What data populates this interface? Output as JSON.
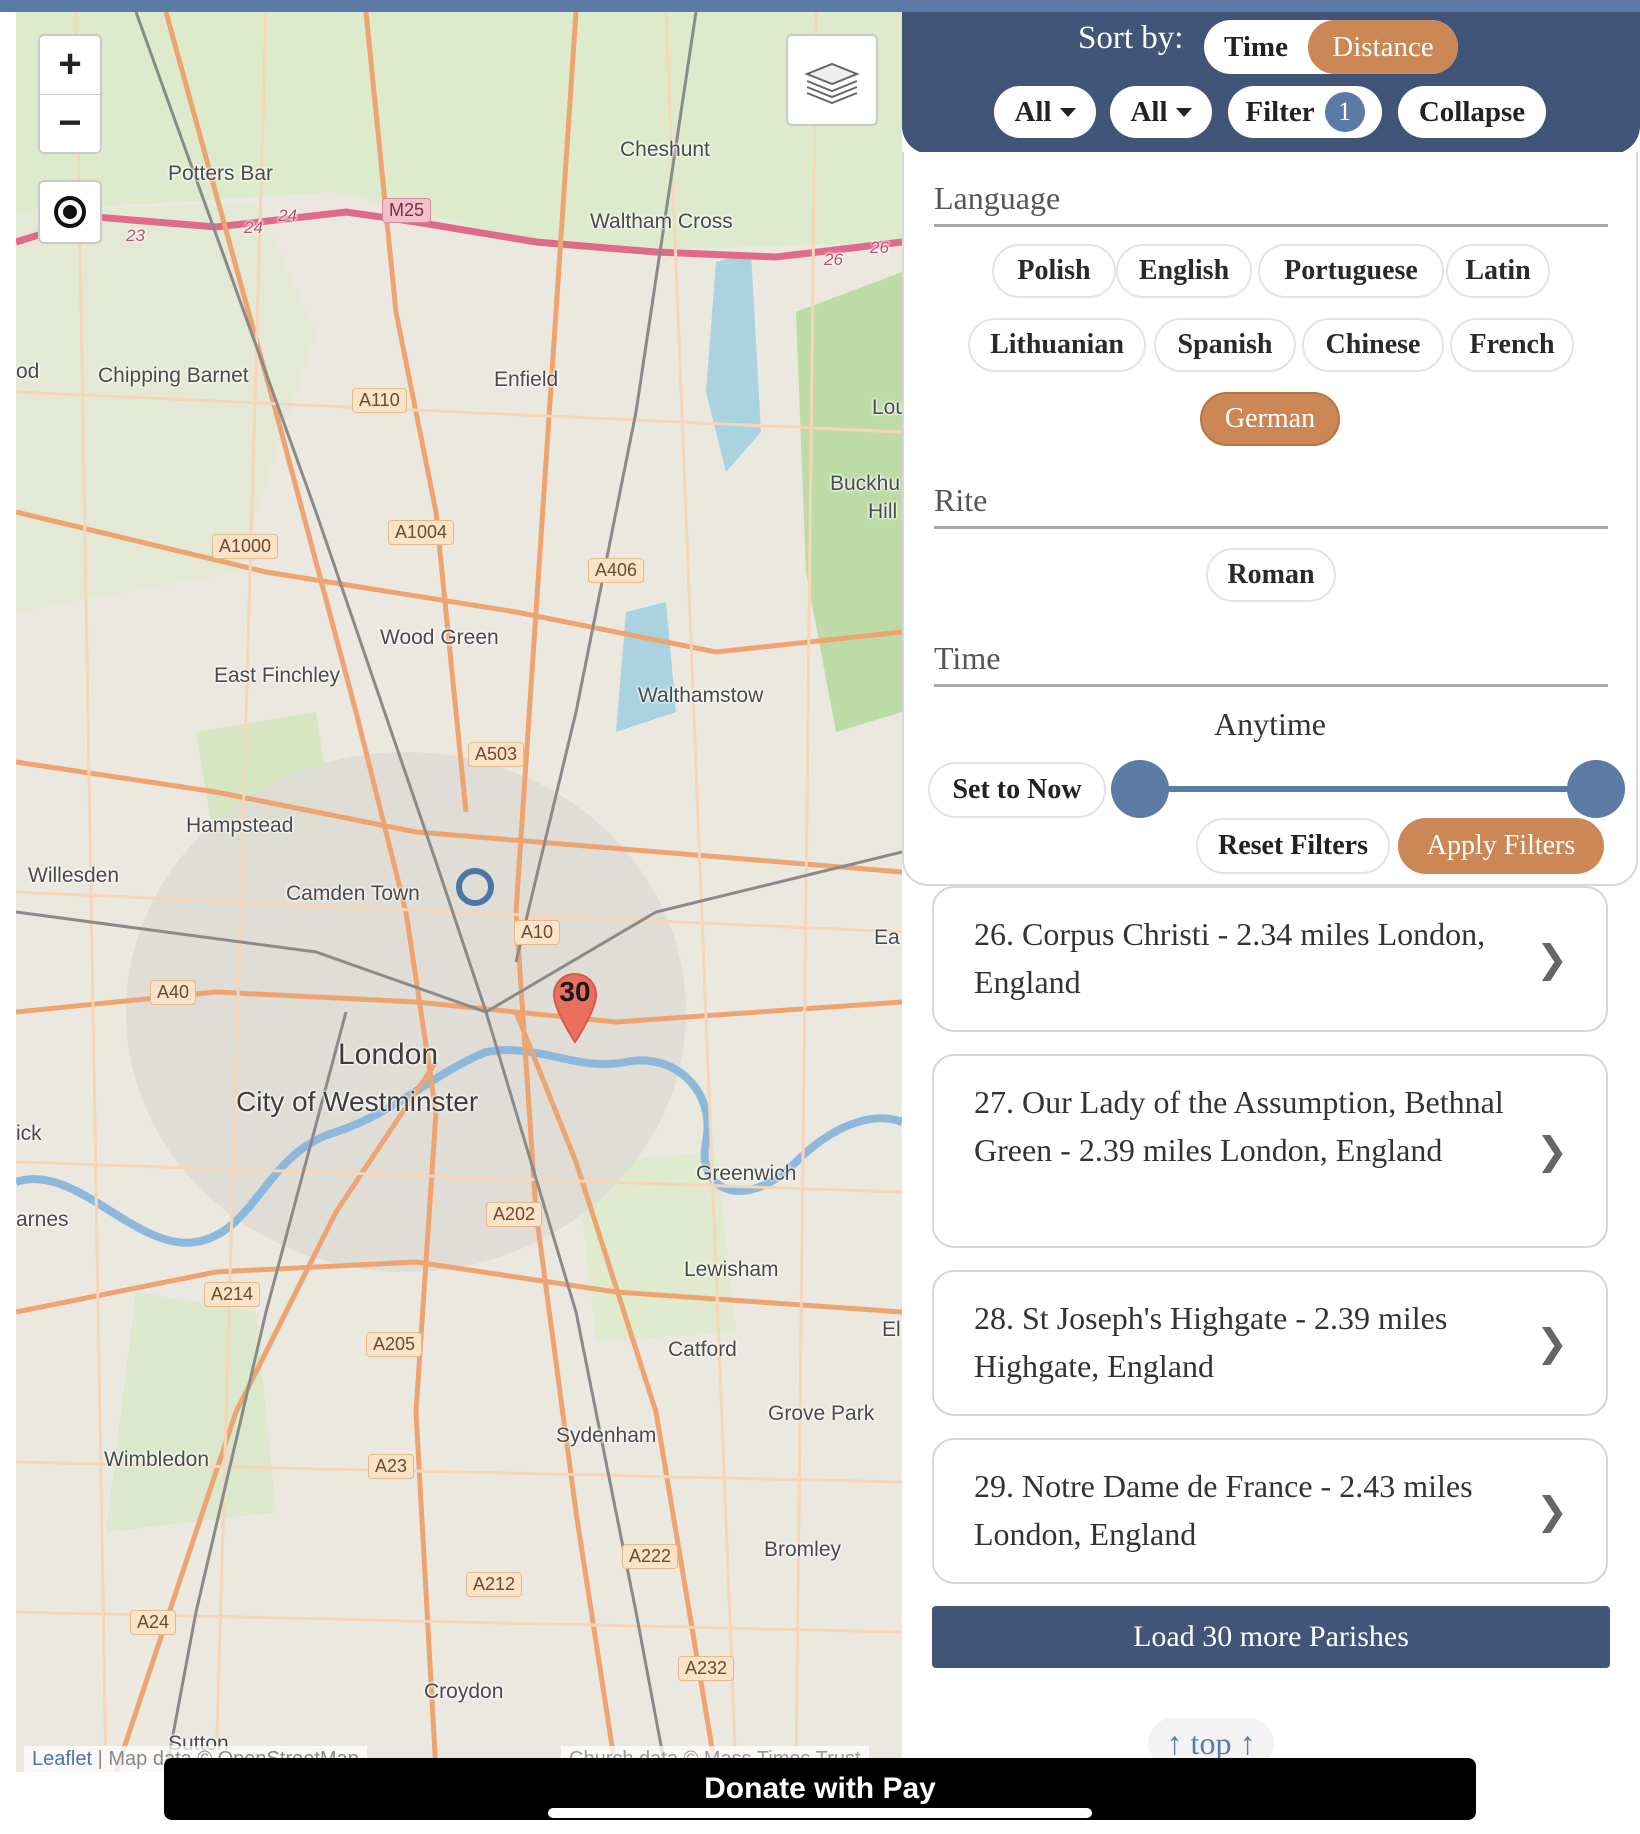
{
  "map": {
    "zoom_in": "+",
    "zoom_out": "−",
    "marker_count": "30",
    "attribution_leaflet": "Leaflet",
    "attribution_map": "| Map data © OpenStreetMap",
    "attribution_church": "Church data © Mass Times Trust",
    "icons": [
      "locate-icon",
      "layers-icon",
      "map-marker-icon",
      "current-location-icon"
    ],
    "labels": {
      "potters_bar": "Potters Bar",
      "cheshunt": "Cheshunt",
      "waltham_cross": "Waltham Cross",
      "chipping_barnet": "Chipping Barnet",
      "enfield": "Enfield",
      "wood_green": "Wood Green",
      "east_finchley": "East Finchley",
      "walthamstow": "Walthamstow",
      "hampstead": "Hampstead",
      "willesden": "Willesden",
      "camden_town": "Camden Town",
      "london": "London",
      "westminster": "City of Westminster",
      "greenwich": "Greenwich",
      "lewisham": "Lewisham",
      "catford": "Catford",
      "grove_park": "Grove Park",
      "sydenham": "Sydenham",
      "wimbledon": "Wimbledon",
      "bromley": "Bromley",
      "croydon": "Croydon",
      "sutton": "Sutton",
      "buckhurst": "Buckhu",
      "hill": "Hill",
      "lou": "Lou",
      "ea": "Ea",
      "el": "El",
      "od": "od",
      "ick": "ick",
      "arnes": "arnes"
    },
    "roads": {
      "m25": "M25",
      "a110": "A110",
      "a1000": "A1000",
      "a1004": "A1004",
      "a406": "A406",
      "a503": "A503",
      "a10": "A10",
      "a40": "A40",
      "a202": "A202",
      "a214": "A214",
      "a205": "A205",
      "a23": "A23",
      "a222": "A222",
      "a212": "A212",
      "a24": "A24",
      "a232": "A232"
    },
    "junctions": {
      "j23": "23",
      "j24a": "24",
      "j24b": "24",
      "j26a": "26",
      "j26b": "26"
    }
  },
  "header": {
    "sort_label": "Sort by:",
    "sort_time": "Time",
    "sort_distance": "Distance",
    "sort_selected": "Distance",
    "dropdown_1": "All",
    "dropdown_2": "All",
    "filter_label": "Filter",
    "filter_count": "1",
    "collapse": "Collapse"
  },
  "filters": {
    "language_title": "Language",
    "languages": [
      "Polish",
      "English",
      "Portuguese",
      "Latin",
      "Lithuanian",
      "Spanish",
      "Chinese",
      "French",
      "German"
    ],
    "selected_language": "German",
    "rite_title": "Rite",
    "rites": [
      "Roman"
    ],
    "time_title": "Time",
    "time_value": "Anytime",
    "set_to_now": "Set to Now",
    "slider_range": [
      0,
      1
    ],
    "reset": "Reset Filters",
    "apply": "Apply Filters"
  },
  "results": [
    {
      "text": "26. Corpus Christi - 2.34 miles London, England"
    },
    {
      "text": "27. Our Lady of the Assumption, Bethnal Green - 2.39 miles London, England"
    },
    {
      "text": "28. St Joseph's Highgate - 2.39 miles Highgate, England"
    },
    {
      "text": "29. Notre Dame de France - 2.43 miles London, England"
    }
  ],
  "chevron": "❯",
  "load_more": "Load 30 more Parishes",
  "top_link": "↑ top ↑",
  "donate": "Donate with  Pay",
  "colors": {
    "navy": "#405577",
    "accent_orange": "#cc8756",
    "accent_blue": "#5b7aa6"
  }
}
